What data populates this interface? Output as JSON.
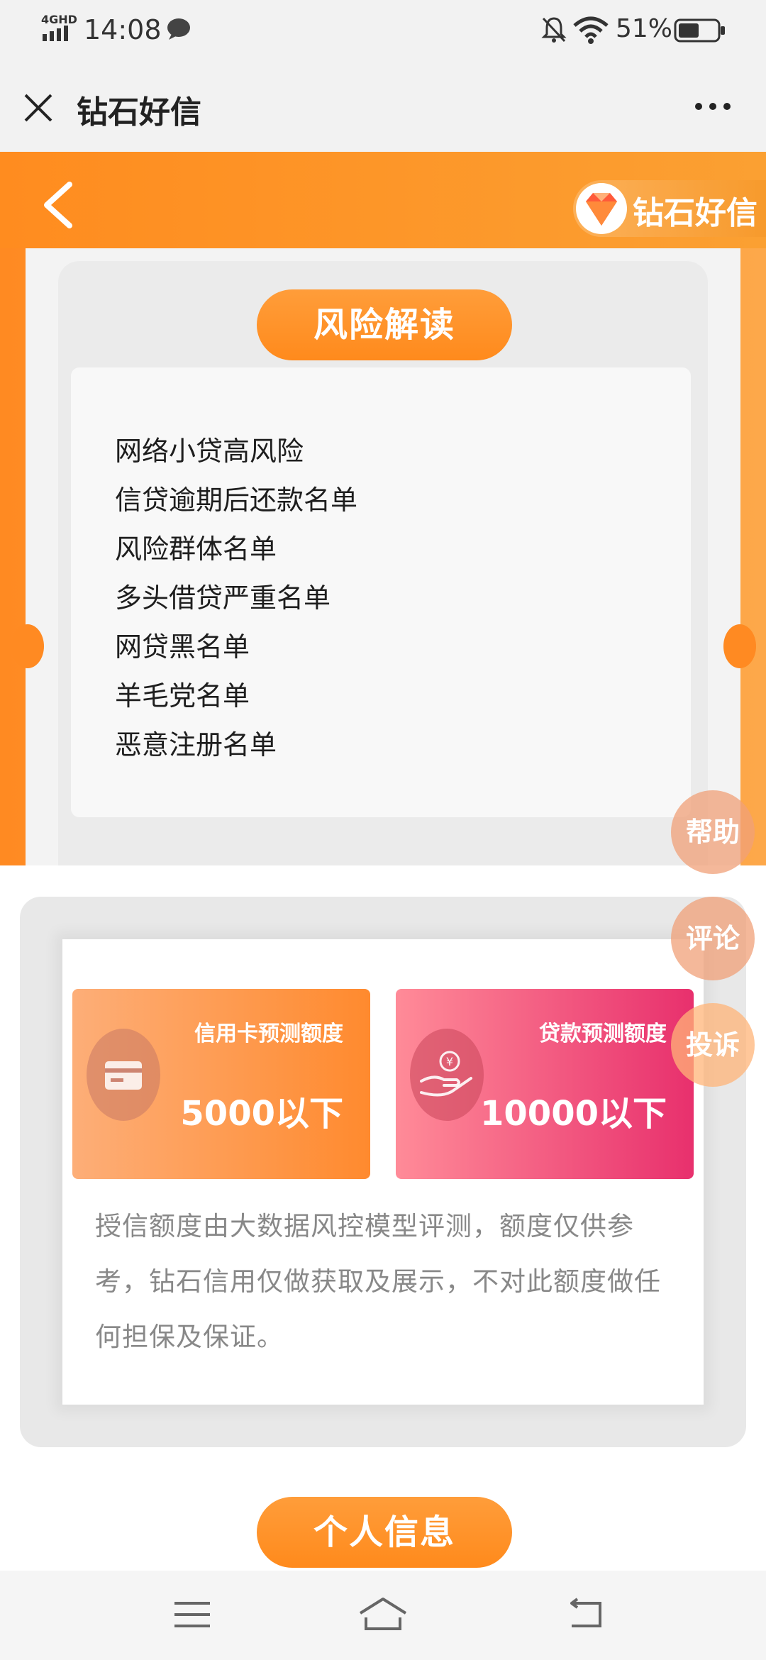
{
  "status_bar": {
    "network": "4GHD",
    "time": "14:08",
    "battery": "51%"
  },
  "app_bar": {
    "title": "钻石好信"
  },
  "header": {
    "brand": "钻石好信"
  },
  "risk": {
    "title": "风险解读",
    "items": [
      "网络小贷高风险",
      "信贷逾期后还款名单",
      "风险群体名单",
      "多头借贷严重名单",
      "网贷黑名单",
      "羊毛党名单",
      "恶意注册名单"
    ]
  },
  "quota": {
    "credit_card": {
      "label": "信用卡预测额度",
      "amount": "5000以下"
    },
    "loan": {
      "label": "贷款预测额度",
      "amount": "10000以下"
    },
    "disclaimer": "授信额度由大数据风控模型评测，额度仅供参考，钻石信用仅做获取及展示，不对此额度做任何担保及保证。"
  },
  "floating": {
    "help": "帮助",
    "comment": "评论",
    "complain": "投诉"
  },
  "personal_info_button": "个人信息",
  "colors": {
    "orange": "#ff8a1c",
    "pink": "#e8306d"
  }
}
